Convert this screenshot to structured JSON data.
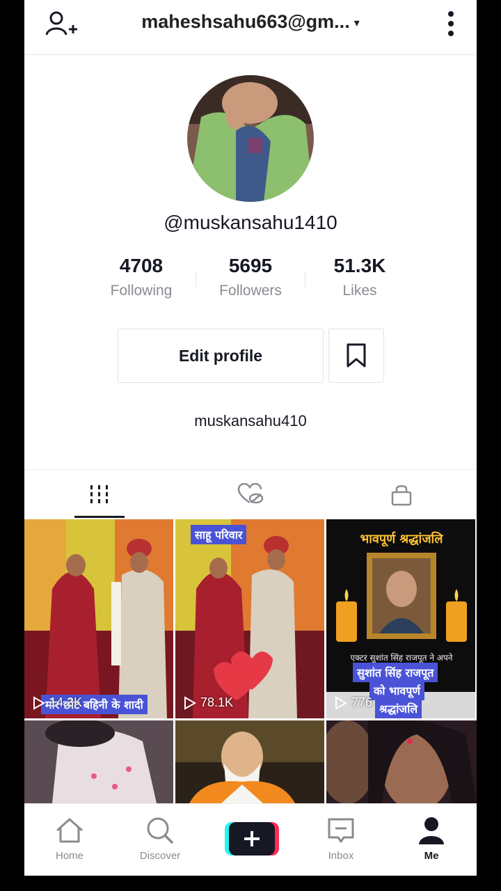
{
  "header": {
    "account_name": "maheshsahu663@gm...",
    "caret": "▾"
  },
  "profile": {
    "username": "@muskansahu1410",
    "bio": "muskansahu410",
    "stats": [
      {
        "value": "4708",
        "label": "Following"
      },
      {
        "value": "5695",
        "label": "Followers"
      },
      {
        "value": "51.3K",
        "label": "Likes"
      }
    ],
    "edit_label": "Edit profile"
  },
  "videos": [
    {
      "views": "14.3K",
      "caption": "मोर छोट बहिनी के शादी"
    },
    {
      "views": "78.1K",
      "caption": "साहू परिवार"
    },
    {
      "views": "776",
      "caption_title": "भावपूर्ण श्रद्धांजलि",
      "caption_line1": "एक्टर सुशांत सिंह राजपूत ने अपने",
      "caption_tag1": "सुशांत सिंह राजपूत",
      "caption_tag2": "को भावपूर्ण",
      "caption_tag3": "श्रद्धांजलि"
    },
    {
      "views": ""
    },
    {
      "views": ""
    },
    {
      "views": ""
    }
  ],
  "nav": {
    "home": "Home",
    "discover": "Discover",
    "inbox": "Inbox",
    "me": "Me"
  },
  "colors": {
    "accent_cyan": "#25f4ee",
    "accent_red": "#fe2c55",
    "text": "#161823",
    "muted": "#8a8b91"
  }
}
